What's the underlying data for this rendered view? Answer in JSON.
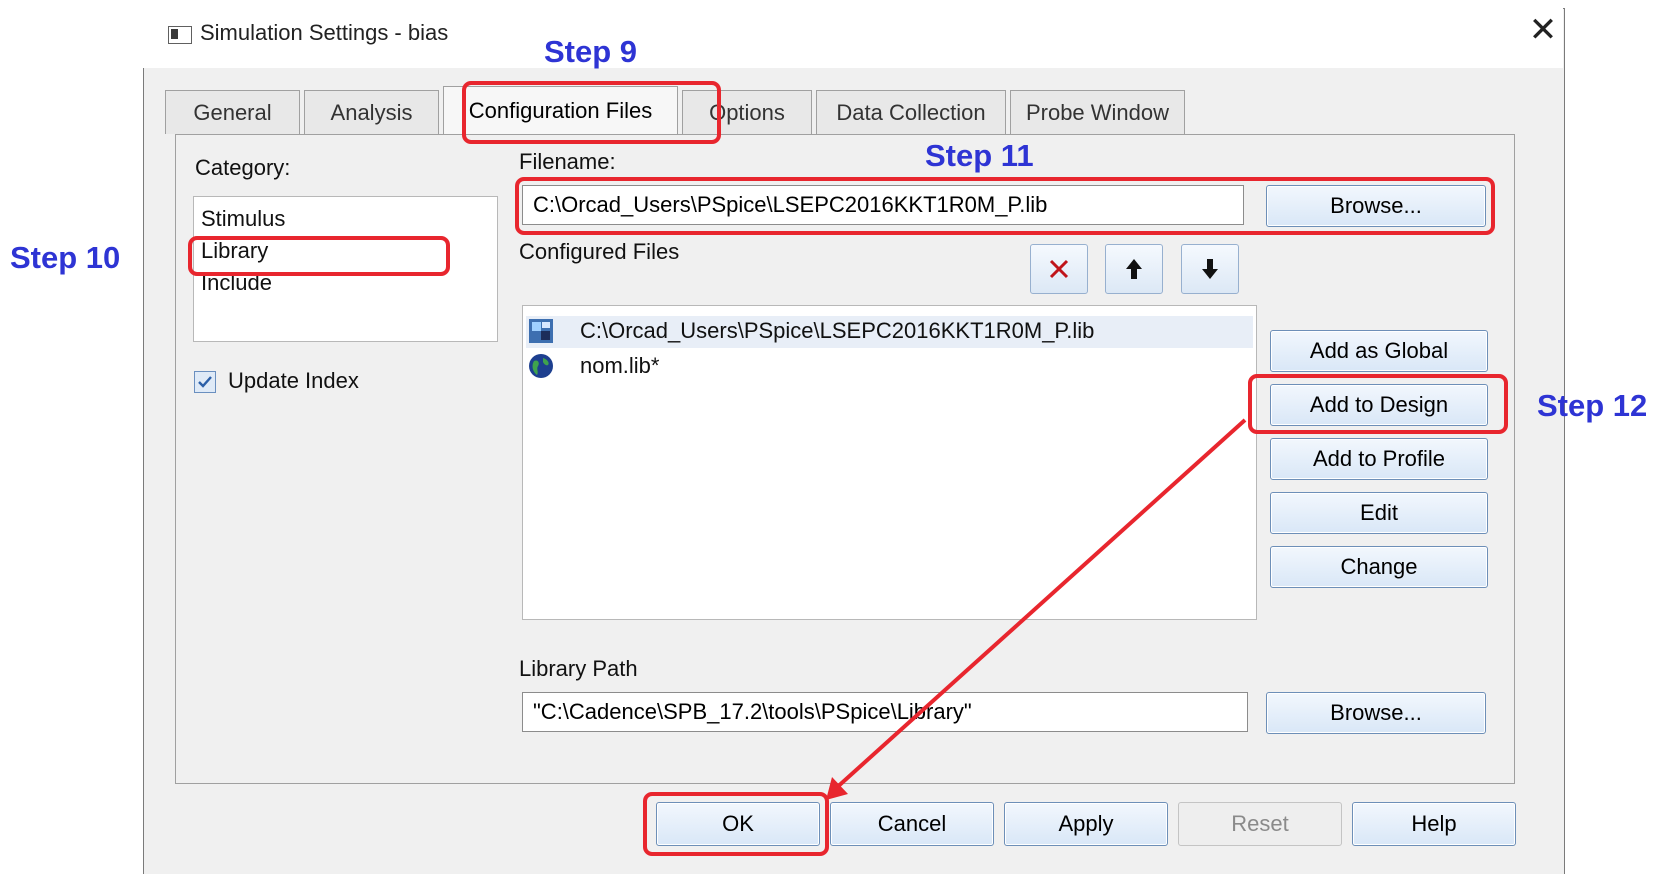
{
  "window": {
    "title": "Simulation Settings - bias"
  },
  "tabs": [
    {
      "label": "General"
    },
    {
      "label": "Analysis"
    },
    {
      "label": "Configuration Files"
    },
    {
      "label": "Options"
    },
    {
      "label": "Data Collection"
    },
    {
      "label": "Probe Window"
    }
  ],
  "active_tab": "Configuration Files",
  "category": {
    "label": "Category:",
    "items": [
      "Stimulus",
      "Library",
      "Include"
    ],
    "selected": "Library"
  },
  "update_index": {
    "label": "Update Index",
    "checked": true
  },
  "filename": {
    "label": "Filename:",
    "value": "C:\\Orcad_Users\\PSpice\\LSEPC2016KKT1R0M_P.lib",
    "browse_label": "Browse..."
  },
  "configured_files": {
    "label": "Configured Files",
    "items": [
      {
        "name": "C:\\Orcad_Users\\PSpice\\LSEPC2016KKT1R0M_P.lib",
        "icon": "design-library-icon"
      },
      {
        "name": "nom.lib*",
        "icon": "global-library-icon"
      }
    ]
  },
  "file_actions": [
    "Add as Global",
    "Add to Design",
    "Add to Profile",
    "Edit",
    "Change"
  ],
  "library_path": {
    "label": "Library Path",
    "value": "\"C:\\Cadence\\SPB_17.2\\tools\\PSpice\\Library\"",
    "browse_label": "Browse..."
  },
  "footer_buttons": {
    "ok": "OK",
    "cancel": "Cancel",
    "apply": "Apply",
    "reset": "Reset",
    "help": "Help"
  },
  "annotations": {
    "step9": "Step 9",
    "step10": "Step 10",
    "step11": "Step 11",
    "step12": "Step 12",
    "color": "#e8262e",
    "step_color": "#2e34d4"
  }
}
